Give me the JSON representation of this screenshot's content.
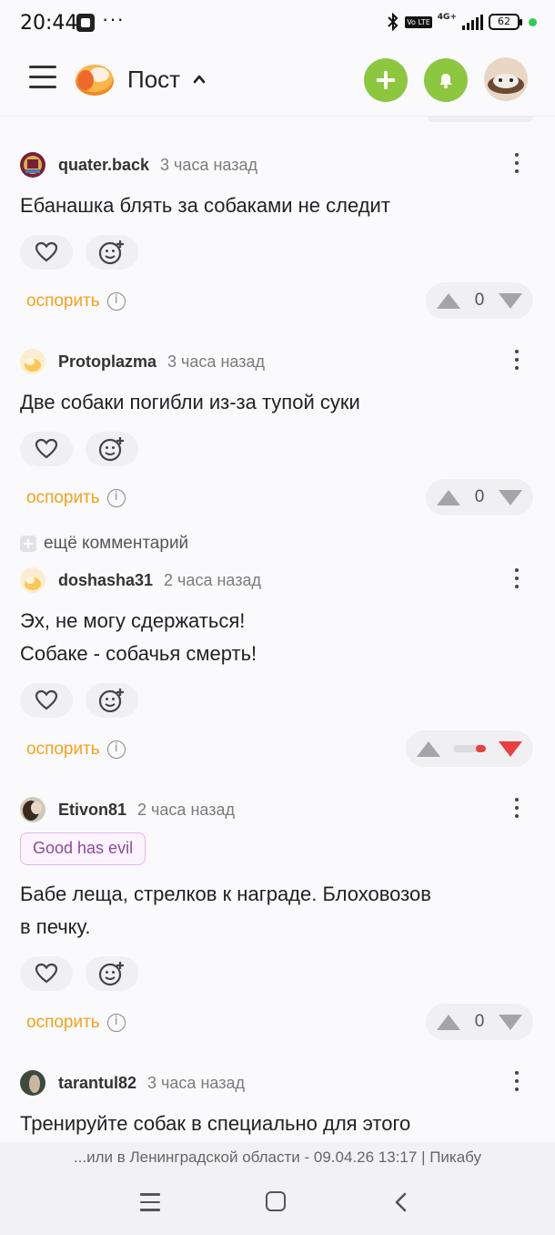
{
  "status_bar": {
    "time": "20:44",
    "more_dots": "···",
    "network": "4G+",
    "volte": "Vo LTE",
    "battery": "62"
  },
  "header": {
    "title": "Пост",
    "icons": [
      "menu-icon",
      "pikabu-logo",
      "chevron-up-icon",
      "plus-icon",
      "bell-icon",
      "avatar"
    ]
  },
  "comments": [
    {
      "username": "quater.back",
      "time": "3 часа назад",
      "text_lines": [
        "Ебанашка блять за собаками не следит"
      ],
      "dispute_label": "оспорить",
      "vote": "0"
    },
    {
      "username": "Protoplazma",
      "time": "3 часа назад",
      "text_lines": [
        "Две собаки погибли из-за тупой суки"
      ],
      "dispute_label": "оспорить",
      "vote": "0"
    },
    {
      "username": "doshasha31",
      "time": "2 часа назад",
      "text_lines": [
        "Эх, не могу сдержаться!",
        "Собаке - собачья смерть!"
      ],
      "dispute_label": "оспорить",
      "vote_ratio_negative": 0.3
    },
    {
      "username": "Etivon81",
      "time": "2 часа назад",
      "badge": "Good has evil",
      "text_lines": [
        "Бабе леща, стрелков к награде. Блоховозов",
        "в печку."
      ],
      "dispute_label": "оспорить",
      "vote": "0"
    },
    {
      "username": "tarantul82",
      "time": "3 часа назад",
      "text_lines": [
        "Тренируйте собак в специально для этого"
      ]
    }
  ],
  "more_comments": {
    "label": "ещё комментарий"
  },
  "footer": {
    "ad_text": "...или в Ленинградской области - 09.04.26 13:17 | Пикабу"
  },
  "colors": {
    "accent_green": "#8dc63f",
    "dispute_orange": "#f4a21b",
    "downvote_red": "#e94040",
    "badge_purple": "#8c4a9e"
  }
}
